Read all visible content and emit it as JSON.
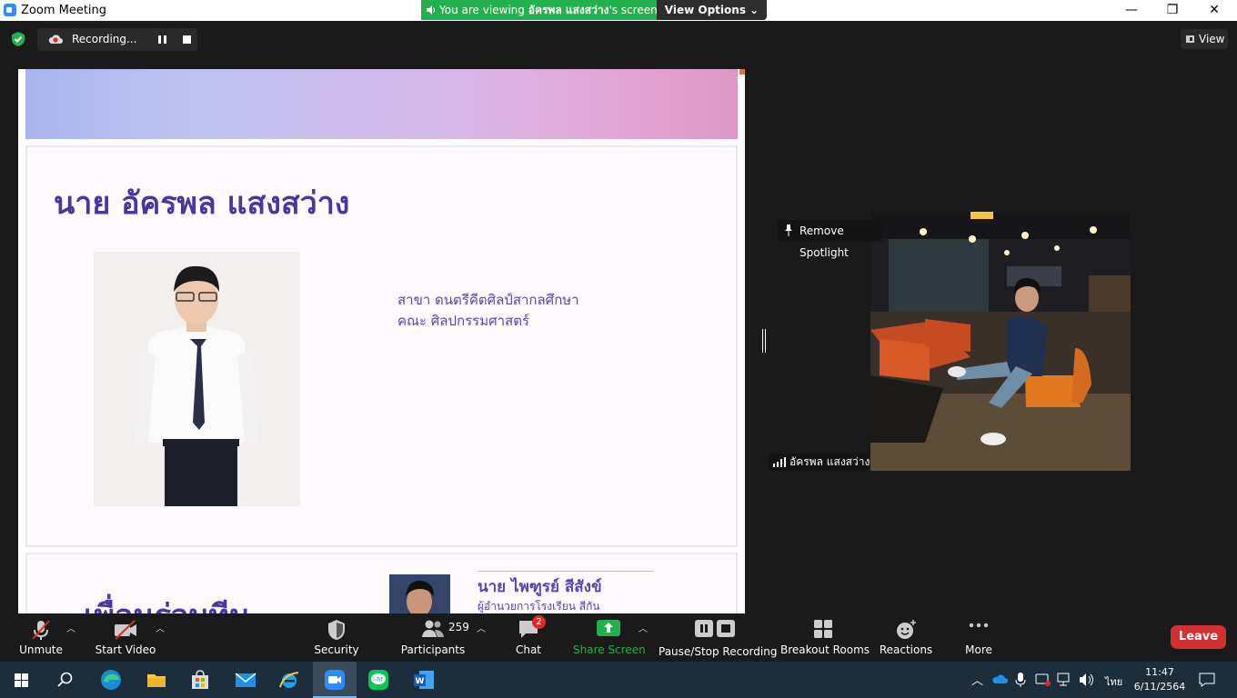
{
  "window": {
    "title": "Zoom Meeting",
    "banner_prefix": "You are viewing ",
    "banner_name": "อัครพล แสงสว่าง",
    "banner_suffix": "'s screen",
    "view_options": "View Options ⌄",
    "minimize": "—",
    "restore": "❐",
    "close": "✕"
  },
  "recording": {
    "label": "Recording..."
  },
  "view_button": "View",
  "slide": {
    "name": "นาย อัครพล แสงสว่าง",
    "info_line1": "สาขา ดนตรีคีตศิลป์สากลศึกษา",
    "info_line2": "คณะ ศิลปกรรมศาสตร์",
    "section_title": "เพื่อนร่วมทีม",
    "teammate_name": "นาย ไพฑูรย์ สีสังข์",
    "teammate_role": "ผู้อำนวยการโรงเรียน สีกัน"
  },
  "spotlight": {
    "remove_label": "Remove Spotlight",
    "participant_name": "อัครพล แสงสว่าง"
  },
  "toolbar": {
    "unmute": "Unmute",
    "start_video": "Start Video",
    "security": "Security",
    "participants": "Participants",
    "participants_count": "259",
    "chat": "Chat",
    "chat_badge": "2",
    "share_screen": "Share Screen",
    "pause_stop": "Pause/Stop Recording",
    "breakout": "Breakout Rooms",
    "reactions": "Reactions",
    "more": "More",
    "leave": "Leave"
  },
  "taskbar": {
    "language": "ไทย",
    "time": "11:47",
    "date": "6/11/2564"
  },
  "colors": {
    "share_green": "#23b14d",
    "leave_red": "#d3302f",
    "slide_purple": "#4d35a0"
  }
}
